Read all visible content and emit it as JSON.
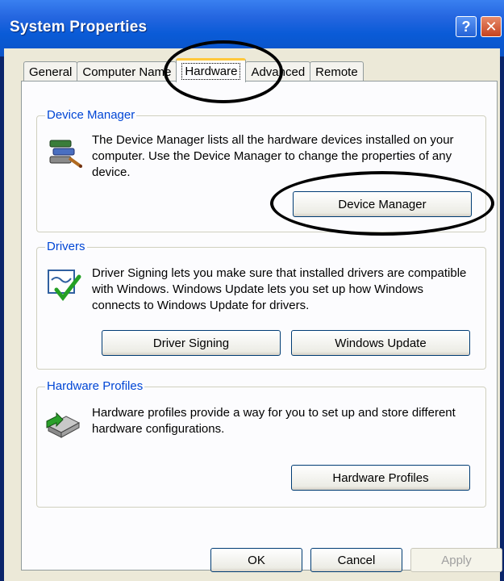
{
  "window": {
    "title": "System Properties",
    "help_label": "?",
    "close_label": "✕"
  },
  "tabs": [
    {
      "label": "General",
      "active": false
    },
    {
      "label": "Computer Name",
      "active": false
    },
    {
      "label": "Hardware",
      "active": true
    },
    {
      "label": "Advanced",
      "active": false
    },
    {
      "label": "Remote",
      "active": false
    }
  ],
  "device_manager": {
    "title": "Device Manager",
    "description": "The Device Manager lists all the hardware devices installed on your computer. Use the Device Manager to change the properties of any device.",
    "button_label": "Device Manager",
    "icon": "device-manager-icon"
  },
  "drivers": {
    "title": "Drivers",
    "description": "Driver Signing lets you make sure that installed drivers are compatible with Windows. Windows Update lets you set up how Windows connects to Windows Update for drivers.",
    "signing_label": "Driver Signing",
    "update_label": "Windows Update",
    "icon": "driver-signing-icon"
  },
  "hardware_profiles": {
    "title": "Hardware Profiles",
    "description": "Hardware profiles provide a way for you to set up and store different hardware configurations.",
    "button_label": "Hardware Profiles",
    "icon": "hardware-profiles-icon"
  },
  "footer": {
    "ok_label": "OK",
    "cancel_label": "Cancel",
    "apply_label": "Apply"
  },
  "colors": {
    "group_title": "#0046d5",
    "titlebar": "#0b53c7",
    "dialog_bg": "#ece9d8"
  }
}
